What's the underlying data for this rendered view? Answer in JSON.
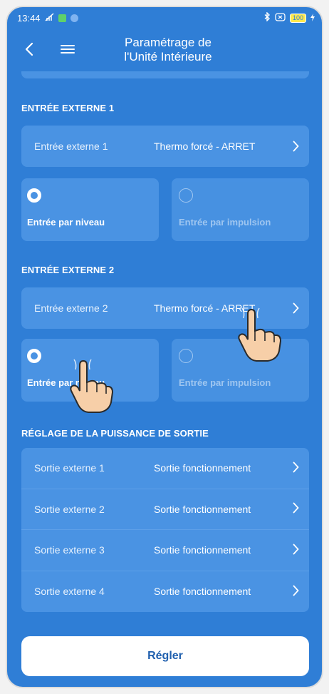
{
  "status_bar": {
    "time": "13:44",
    "battery": "100"
  },
  "header": {
    "title_line1": "Paramétrage de",
    "title_line2": "l'Unité Intérieure"
  },
  "sections": {
    "external_input_1": {
      "title": "ENTRÉE EXTERNE 1",
      "row_label": "Entrée externe 1",
      "row_value": "Thermo forcé - ARRET",
      "option_level": "Entrée par niveau",
      "option_pulse": "Entrée par impulsion",
      "selected": "level"
    },
    "external_input_2": {
      "title": "ENTRÉE EXTERNE 2",
      "row_label": "Entrée externe 2",
      "row_value": "Thermo forcé - ARRET",
      "option_level": "Entrée par niveau",
      "option_pulse": "Entrée par impulsion",
      "selected": "level"
    },
    "output_power": {
      "title": "RÉGLAGE DE LA PUISSANCE DE SORTIE",
      "rows": [
        {
          "label": "Sortie externe 1",
          "value": "Sortie fonctionnement"
        },
        {
          "label": "Sortie externe 2",
          "value": "Sortie fonctionnement"
        },
        {
          "label": "Sortie externe 3",
          "value": "Sortie fonctionnement"
        },
        {
          "label": "Sortie externe 4",
          "value": "Sortie fonctionnement"
        }
      ]
    }
  },
  "apply_button": "Régler",
  "colors": {
    "background": "#2f7ed6",
    "card": "#4a93e3",
    "button_text": "#1f5fae"
  },
  "icons": [
    "back-chevron-icon",
    "menu-icon",
    "chevron-right-icon",
    "radio-selected-icon",
    "radio-unselected-icon",
    "pointing-hand-icon"
  ]
}
